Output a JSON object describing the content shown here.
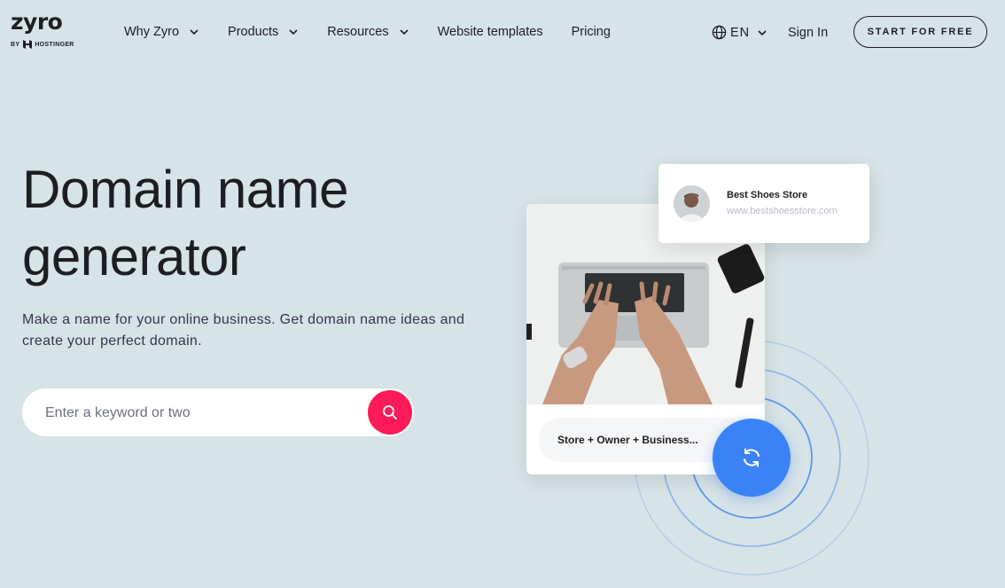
{
  "brand": {
    "logo_text": "zyro",
    "by_prefix": "BY",
    "by_name": "HOSTINGER"
  },
  "nav": {
    "items": [
      {
        "label": "Why Zyro",
        "has_dropdown": true
      },
      {
        "label": "Products",
        "has_dropdown": true
      },
      {
        "label": "Resources",
        "has_dropdown": true
      },
      {
        "label": "Website templates",
        "has_dropdown": false
      },
      {
        "label": "Pricing",
        "has_dropdown": false
      }
    ],
    "language": "EN",
    "sign_in": "Sign In",
    "cta": "START FOR FREE"
  },
  "hero": {
    "title_line1": "Domain name",
    "title_line2": "generator",
    "subtitle": "Make a name for your online business. Get domain name ideas and create your perfect domain.",
    "search_placeholder": "Enter a keyword or two",
    "search_value": ""
  },
  "illustration": {
    "profile_name": "Best Shoes Store",
    "profile_url": "www.bestshoesstore.com",
    "suggestion": "Store + Owner + Business..."
  },
  "colors": {
    "background": "#d6e3e7",
    "search_button": "#fc1a5a",
    "refresh_button": "#3b82f6",
    "text": "#1d1e20"
  },
  "icons": {
    "search": "search-icon",
    "refresh": "refresh-icon",
    "globe": "globe-icon",
    "chevron": "chevron-down-icon"
  }
}
